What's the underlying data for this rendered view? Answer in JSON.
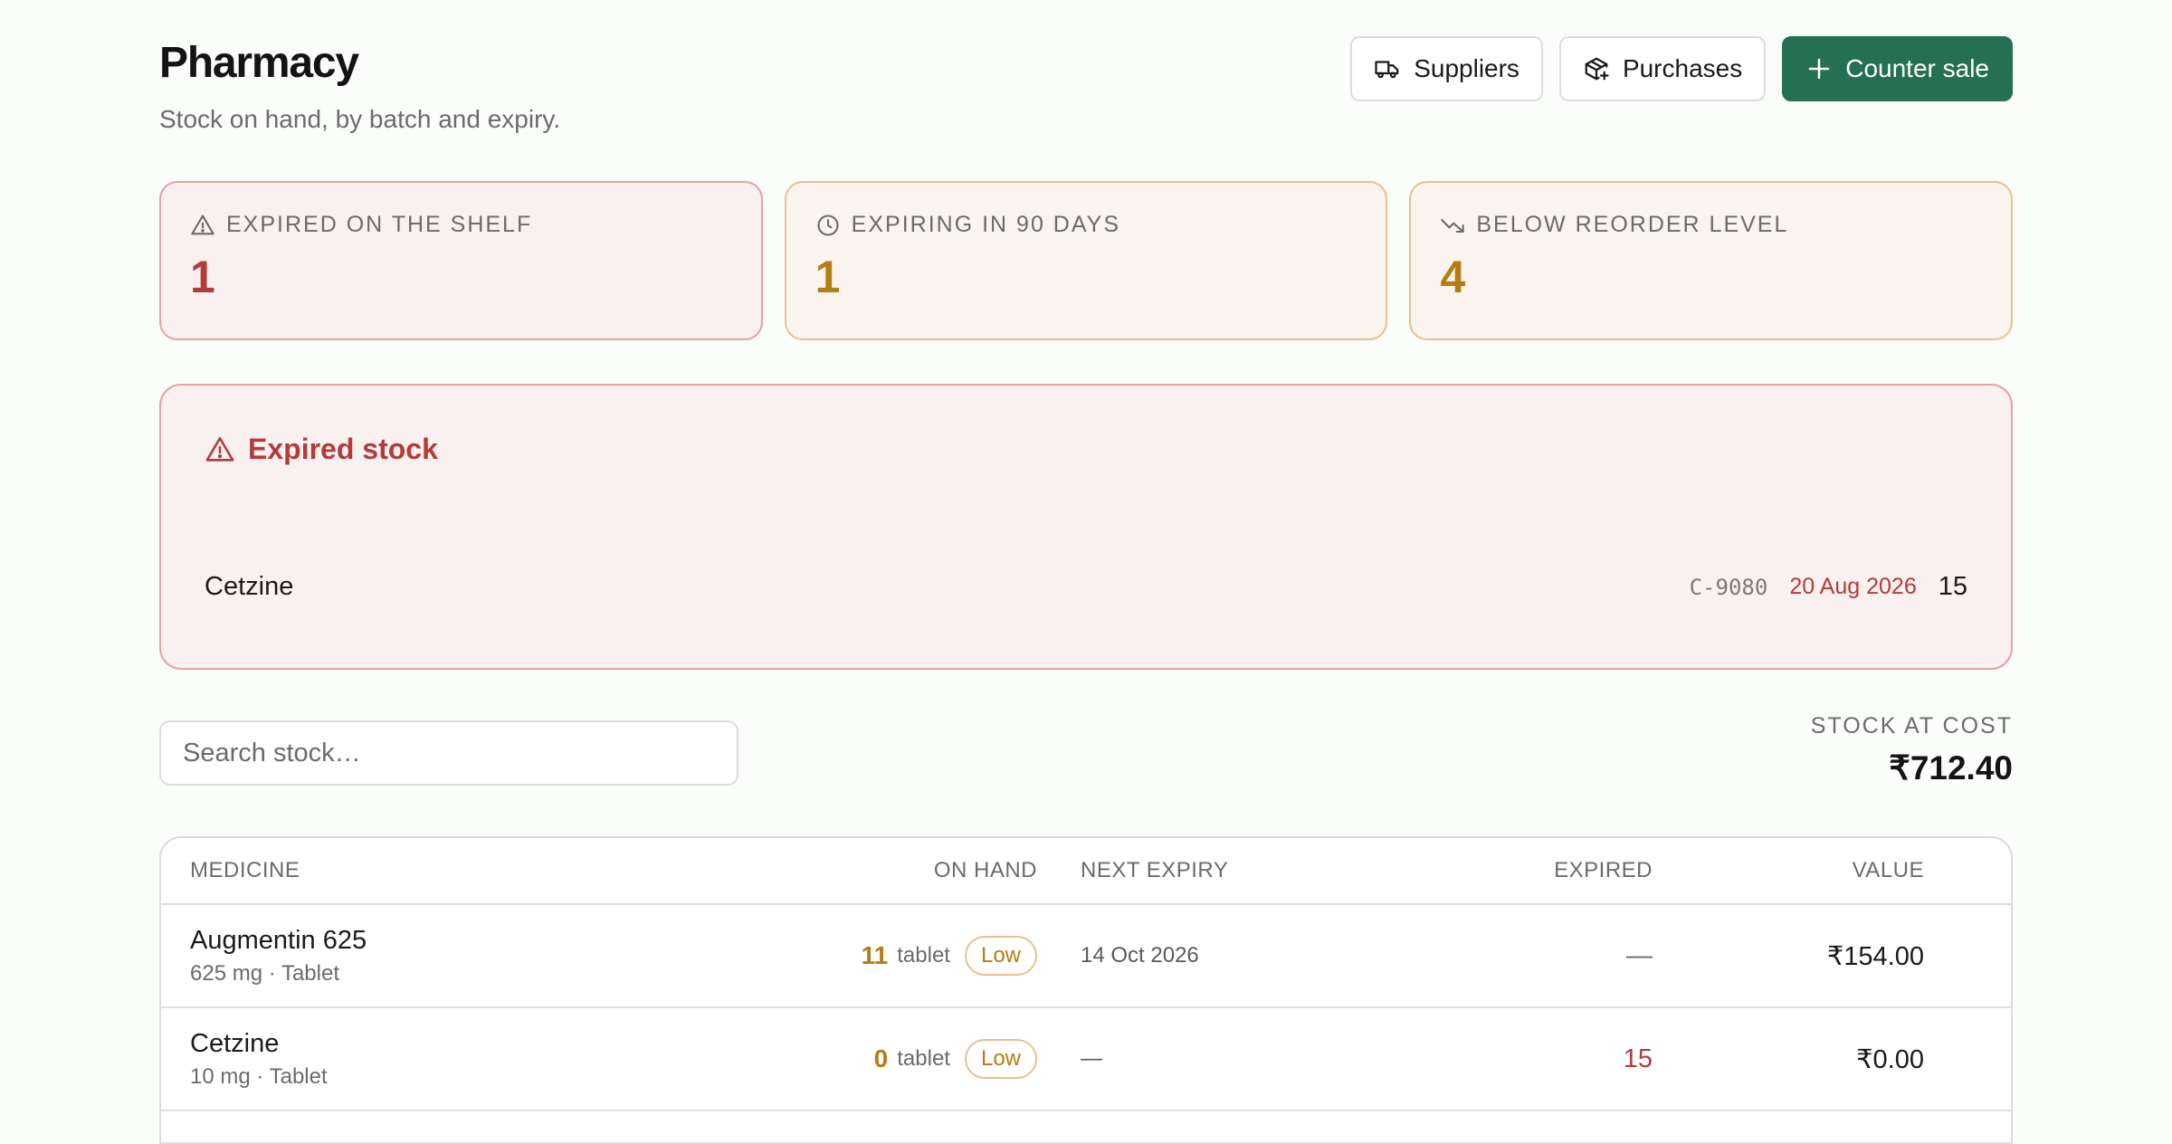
{
  "header": {
    "title": "Pharmacy",
    "subtitle": "Stock on hand, by batch and expiry.",
    "buttons": {
      "suppliers": "Suppliers",
      "purchases": "Purchases",
      "counter_sale": "Counter sale"
    }
  },
  "stats": [
    {
      "label": "EXPIRED ON THE SHELF",
      "value": "1",
      "icon": "alert-triangle-icon",
      "color": "#b23b3b"
    },
    {
      "label": "EXPIRING IN 90 DAYS",
      "value": "1",
      "icon": "clock-icon",
      "color": "#b57d15"
    },
    {
      "label": "BELOW REORDER LEVEL",
      "value": "4",
      "icon": "trending-down-icon",
      "color": "#b57d15"
    }
  ],
  "expired_panel": {
    "title": "Expired stock",
    "items": [
      {
        "name": "Cetzine",
        "batch": "C-9080",
        "expiry": "20 Aug 2026",
        "qty": "15"
      }
    ]
  },
  "search": {
    "placeholder": "Search stock…",
    "value": ""
  },
  "stock_cost": {
    "label": "STOCK AT COST",
    "value": "₹712.40"
  },
  "table": {
    "headers": {
      "medicine": "MEDICINE",
      "on_hand": "ON HAND",
      "next_expiry": "NEXT EXPIRY",
      "expired": "EXPIRED",
      "value": "VALUE"
    },
    "rows": [
      {
        "name": "Augmentin 625",
        "detail": "625 mg · Tablet",
        "qty": "11",
        "unit": "tablet",
        "badge": "Low",
        "next_expiry": "14 Oct 2026",
        "expired": "—",
        "value": "₹154.00"
      },
      {
        "name": "Cetzine",
        "detail": "10 mg · Tablet",
        "qty": "0",
        "unit": "tablet",
        "badge": "Low",
        "next_expiry": "—",
        "expired": "15",
        "value": "₹0.00"
      }
    ]
  },
  "colors": {
    "brand": "#247050",
    "danger": "#b23b3b",
    "warning": "#b57d15"
  }
}
